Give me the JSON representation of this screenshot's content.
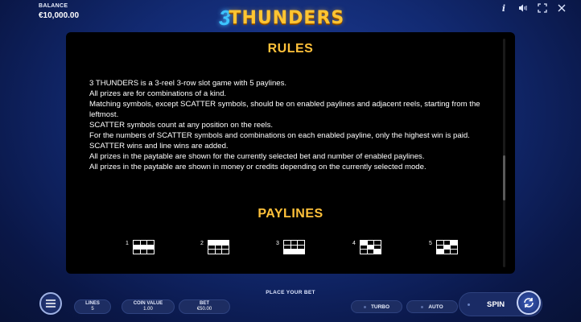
{
  "header": {
    "balance_label": "BALANCE",
    "balance_value": "€10,000.00",
    "logo_number": "3",
    "logo_text": "THUNDERS",
    "icons": [
      "info-icon",
      "sound-icon",
      "fullscreen-icon",
      "close-icon"
    ],
    "info_glyph": "i"
  },
  "rules": {
    "title": "RULES",
    "lines": [
      "3 THUNDERS is a 3-reel 3-row slot game with 5 paylines.",
      "All prizes are for combinations of a kind.",
      "Matching symbols, except SCATTER symbols, should be on enabled paylines and adjacent reels, starting from the leftmost.",
      "SCATTER symbols count at any position on the reels.",
      "For the numbers of SCATTER symbols and combinations on each enabled payline, only the highest win is paid.",
      "SCATTER wins and line wins are added.",
      "All prizes in the paytable are shown for the currently selected bet and number of enabled paylines.",
      "All prizes in the paytable are shown in money or credits depending on the currently selected mode."
    ]
  },
  "paylines": {
    "title": "PAYLINES",
    "items": [
      {
        "number": "1",
        "rows": [
          1,
          1,
          1
        ]
      },
      {
        "number": "2",
        "rows": [
          0,
          0,
          0
        ]
      },
      {
        "number": "3",
        "rows": [
          2,
          2,
          2
        ]
      },
      {
        "number": "4",
        "rows": [
          0,
          1,
          2
        ]
      },
      {
        "number": "5",
        "rows": [
          2,
          1,
          0
        ]
      }
    ]
  },
  "footer": {
    "place_bet": "PLACE YOUR BET",
    "lines_label": "LINES",
    "lines_value": "5",
    "coin_label": "COIN VALUE",
    "coin_value": "1.00",
    "bet_label": "BET",
    "bet_value": "€50.00",
    "turbo": "TURBO",
    "auto": "AUTO",
    "spin": "SPIN"
  },
  "colors": {
    "accent_gold": "#ffc13a",
    "background_blue": "#122a72",
    "panel": "#000000"
  }
}
